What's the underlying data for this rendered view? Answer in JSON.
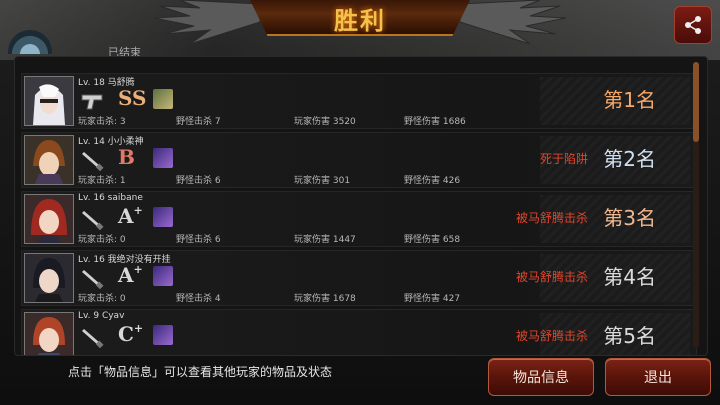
{
  "header": {
    "title": "胜利",
    "mode_label": "已结束"
  },
  "players": [
    {
      "level_name": "Lv. 18 马舒腾",
      "grade": "SS",
      "grade_plus": "",
      "player_kills": "玩家击杀: 3",
      "monster_kills": "野怪击杀 7",
      "player_damage": "玩家伤害 3520",
      "monster_damage": "野怪伤害 1686",
      "death_cause": "",
      "rank": "第1名"
    },
    {
      "level_name": "Lv. 14 小小柔神",
      "grade": "B",
      "grade_plus": "",
      "player_kills": "玩家击杀: 1",
      "monster_kills": "野怪击杀 6",
      "player_damage": "玩家伤害 301",
      "monster_damage": "野怪伤害 426",
      "death_cause": "死于陷阱",
      "rank": "第2名"
    },
    {
      "level_name": "Lv. 16 saibane",
      "grade": "A",
      "grade_plus": "+",
      "player_kills": "玩家击杀: 0",
      "monster_kills": "野怪击杀 6",
      "player_damage": "玩家伤害 1447",
      "monster_damage": "野怪伤害 658",
      "death_cause": "被马舒腾击杀",
      "rank": "第3名"
    },
    {
      "level_name": "Lv. 16 我绝对没有开挂",
      "grade": "A",
      "grade_plus": "+",
      "player_kills": "玩家击杀: 0",
      "monster_kills": "野怪击杀 4",
      "player_damage": "玩家伤害 1678",
      "monster_damage": "野怪伤害 427",
      "death_cause": "被马舒腾击杀",
      "rank": "第4名"
    },
    {
      "level_name": "Lv. 9 Cyav",
      "grade": "C",
      "grade_plus": "+",
      "player_kills": "",
      "monster_kills": "",
      "player_damage": "",
      "monster_damage": "",
      "death_cause": "被马舒腾击杀",
      "rank": "第5名"
    }
  ],
  "footer": {
    "hint": "点击「物品信息」可以查看其他玩家的物品及状态",
    "items_button": "物品信息",
    "exit_button": "退出"
  },
  "colors": {
    "accent_gold": "#f2c24a",
    "death_red": "#e0462c",
    "rank_first": "#f6a86a",
    "button_red": "#7a2416"
  },
  "icons": [
    "share-icon",
    "pistol-icon",
    "knife-icon",
    "skill-icon"
  ]
}
